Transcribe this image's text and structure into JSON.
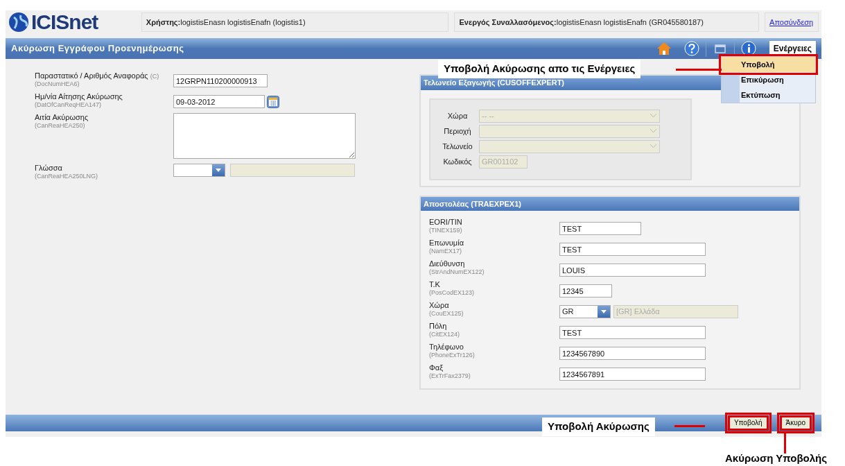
{
  "header": {
    "logo": "ICISnet",
    "user_label": "Χρήστης:",
    "user_value": "logistisEnasn logistisEnafn (logistis1)",
    "partner_label": "Ενεργός Συναλλασόμενος:",
    "partner_value": "logistisEnasn logistisEnafn (GR045580187)",
    "logout": "Αποσύνδεση"
  },
  "title_bar": {
    "title": "Ακύρωση Εγγράφου Προενημέρωσης",
    "actions_button": "Ενέργειες"
  },
  "actions_menu": {
    "items": [
      {
        "label": "Υποβολή",
        "selected": true,
        "highlighted": true
      },
      {
        "label": "Επικύρωση",
        "selected": false,
        "highlighted": false
      },
      {
        "label": "Εκτύπωση",
        "selected": false,
        "highlighted": false
      }
    ]
  },
  "form": {
    "fields": [
      {
        "kind": "text",
        "label": "Παραστατικό / Αριθμός Αναφοράς",
        "suffix": "(C)",
        "code": "(DocNumHEA6)",
        "value": "12GRPN110200000913"
      },
      {
        "kind": "date",
        "label": "Ημ/νία Αίτησης Ακύρωσης",
        "code": "(DatOfCanReqHEA147)",
        "value": "09-03-2012"
      },
      {
        "kind": "textarea",
        "label": "Αιτία Ακύρωσης",
        "code": "(CanReaHEA250)"
      },
      {
        "kind": "select",
        "label": "Γλώσσα",
        "code": "(CanReaHEA250LNG)"
      }
    ]
  },
  "customs_office_panel": {
    "title": "Τελωνείο Εξαγωγής (CUSOFFEXPERT)",
    "fields": [
      {
        "kind": "select",
        "label": "Χώρα",
        "value": "-- --",
        "disabled": true
      },
      {
        "kind": "select",
        "label": "Περιοχή",
        "disabled": true
      },
      {
        "kind": "select",
        "label": "Τελωνείο",
        "disabled": true
      },
      {
        "kind": "text",
        "label": "Κωδικός",
        "value": "GR001102",
        "disabled": true
      }
    ]
  },
  "consignor_panel": {
    "title": "Αποστολέας (TRAEXPEX1)",
    "fields": [
      {
        "kind": "text",
        "label": "EORI/TIN",
        "code": "(TINEX159)",
        "value": "TEST"
      },
      {
        "kind": "text",
        "label": "Επωνυμία",
        "code": "(NamEX17)",
        "value": "TEST"
      },
      {
        "kind": "text",
        "label": "Διεύθυνση",
        "code": "(StrAndNumEX122)",
        "value": "LOUIS"
      },
      {
        "kind": "text",
        "label": "Τ.Κ",
        "code": "(PosCodEX123)",
        "value": "12345"
      },
      {
        "kind": "select",
        "label": "Χώρα",
        "code": "(CouEX125)",
        "value": "GR",
        "description": "[GR] Ελλάδα"
      },
      {
        "kind": "text",
        "label": "Πόλη",
        "code": "(CitEX124)",
        "value": "TEST"
      },
      {
        "kind": "text",
        "label": "Τηλέφωνο",
        "code": "(PhoneExTr126)",
        "value": "1234567890"
      },
      {
        "kind": "text",
        "label": "Φαξ",
        "code": "(ExTrFax2379)",
        "value": "1234567891"
      }
    ]
  },
  "footer": {
    "buttons": [
      {
        "label": "Υποβολή",
        "highlighted": true
      },
      {
        "label": "Άκυρο",
        "highlighted": true
      }
    ]
  },
  "annotations": [
    {
      "text": "Υποβολή Ακύρωσης απο τις Ενέργειες"
    },
    {
      "text": "Υποβολή Ακύρωσης"
    },
    {
      "text": "Ακύρωση Υποβολής"
    }
  ]
}
